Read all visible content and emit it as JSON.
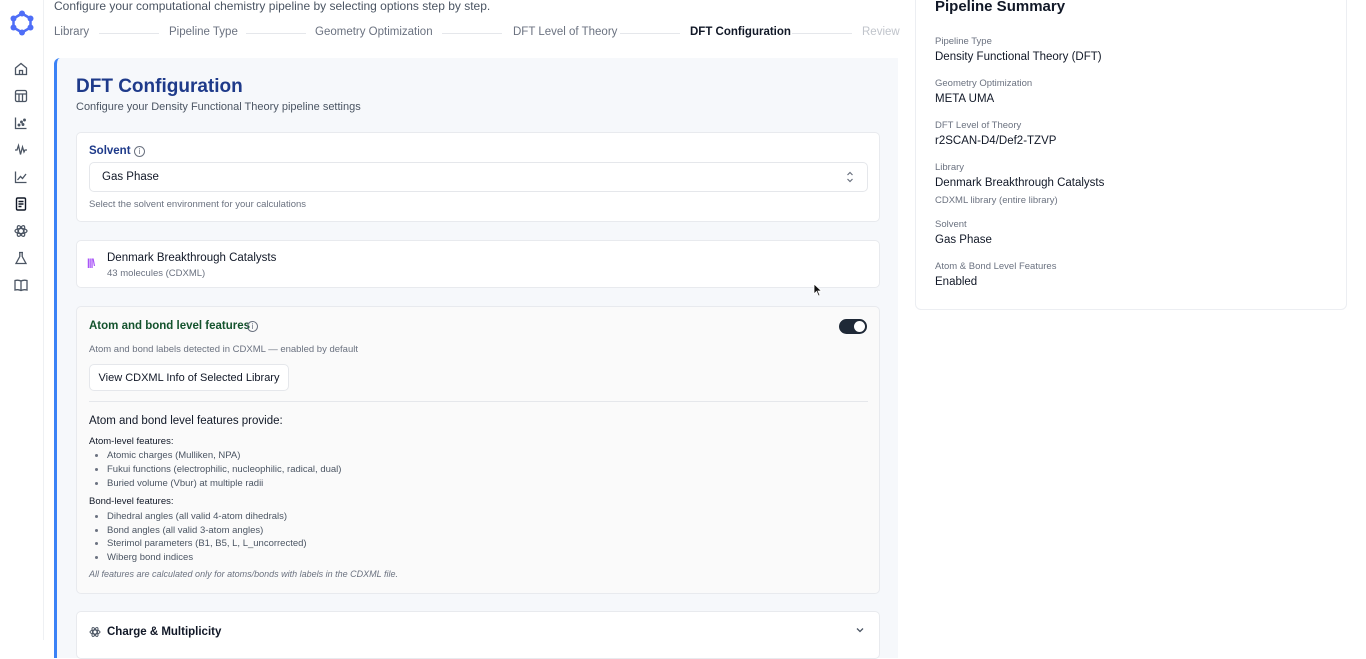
{
  "intro": "Configure your computational chemistry pipeline by selecting options step by step.",
  "sidebar": {
    "icons": [
      "home-icon",
      "table-icon",
      "scatter-chart-icon",
      "waveform-icon",
      "line-chart-icon",
      "document-icon",
      "atom-icon",
      "flask-icon",
      "book-icon"
    ]
  },
  "stepper": {
    "steps": [
      "Library",
      "Pipeline Type",
      "Geometry Optimization",
      "DFT Level of Theory",
      "DFT Configuration",
      "Review"
    ],
    "active": "DFT Configuration"
  },
  "config": {
    "title": "DFT Configuration",
    "subtitle": "Configure your Density Functional Theory pipeline settings",
    "solvent": {
      "label": "Solvent",
      "value": "Gas Phase",
      "hint": "Select the solvent environment for your calculations"
    },
    "library": {
      "name": "Denmark Breakthrough Catalysts",
      "detail": "43 molecules (CDXML)"
    },
    "features": {
      "title": "Atom and bond level features",
      "enabled": true,
      "hint": "Atom and bond labels detected in CDXML — enabled by default",
      "view_button": "View CDXML Info of Selected Library",
      "provide_title": "Atom and bond level features provide:",
      "atom_title": "Atom-level features:",
      "atom_items": [
        "Atomic charges (Mulliken, NPA)",
        "Fukui functions (electrophilic, nucleophilic, radical, dual)",
        "Buried volume (Vbur) at multiple radii"
      ],
      "bond_title": "Bond-level features:",
      "bond_items": [
        "Dihedral angles (all valid 4-atom dihedrals)",
        "Bond angles (all valid 3-atom angles)",
        "Sterimol parameters (B1, B5, L, L_uncorrected)",
        "Wiberg bond indices"
      ],
      "note": "All features are calculated only for atoms/bonds with labels in the CDXML file."
    },
    "charge": {
      "label": "Charge & Multiplicity"
    }
  },
  "summary": {
    "title": "Pipeline Summary",
    "items": [
      {
        "label": "Pipeline Type",
        "value": "Density Functional Theory (DFT)"
      },
      {
        "label": "Geometry Optimization",
        "value": "META UMA"
      },
      {
        "label": "DFT Level of Theory",
        "value": "r2SCAN-D4/Def2-TZVP"
      },
      {
        "label": "Library",
        "value": "Denmark Breakthrough Catalysts",
        "sub": "CDXML library (entire library)"
      },
      {
        "label": "Solvent",
        "value": "Gas Phase"
      },
      {
        "label": "Atom & Bond Level Features",
        "value": "Enabled"
      }
    ]
  },
  "colors": {
    "accent": "#3b82f6",
    "title_blue": "#1e3a8a",
    "feature_green": "#14532d",
    "library_purple": "#a855f7"
  }
}
